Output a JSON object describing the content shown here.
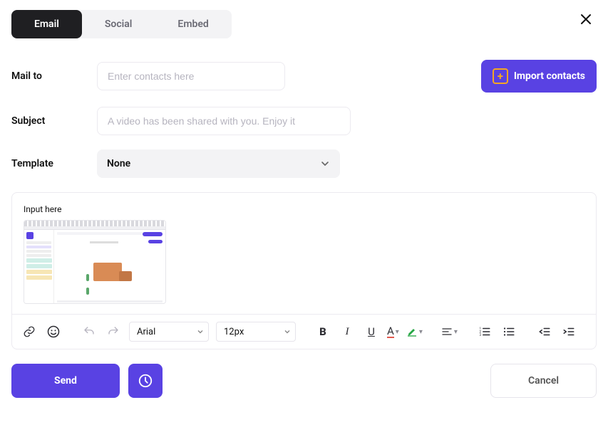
{
  "tabs": {
    "email": "Email",
    "social": "Social",
    "embed": "Embed"
  },
  "labels": {
    "mail_to": "Mail to",
    "subject": "Subject",
    "template": "Template"
  },
  "mail_to": {
    "placeholder": "Enter contacts here",
    "value": ""
  },
  "import_btn": "Import contacts",
  "subject": {
    "placeholder": "A video has been shared with you. Enjoy it",
    "value": ""
  },
  "template": {
    "selected": "None"
  },
  "editor": {
    "placeholder": "Input here",
    "font": "Arial",
    "size": "12px"
  },
  "footer": {
    "send": "Send",
    "cancel": "Cancel"
  }
}
